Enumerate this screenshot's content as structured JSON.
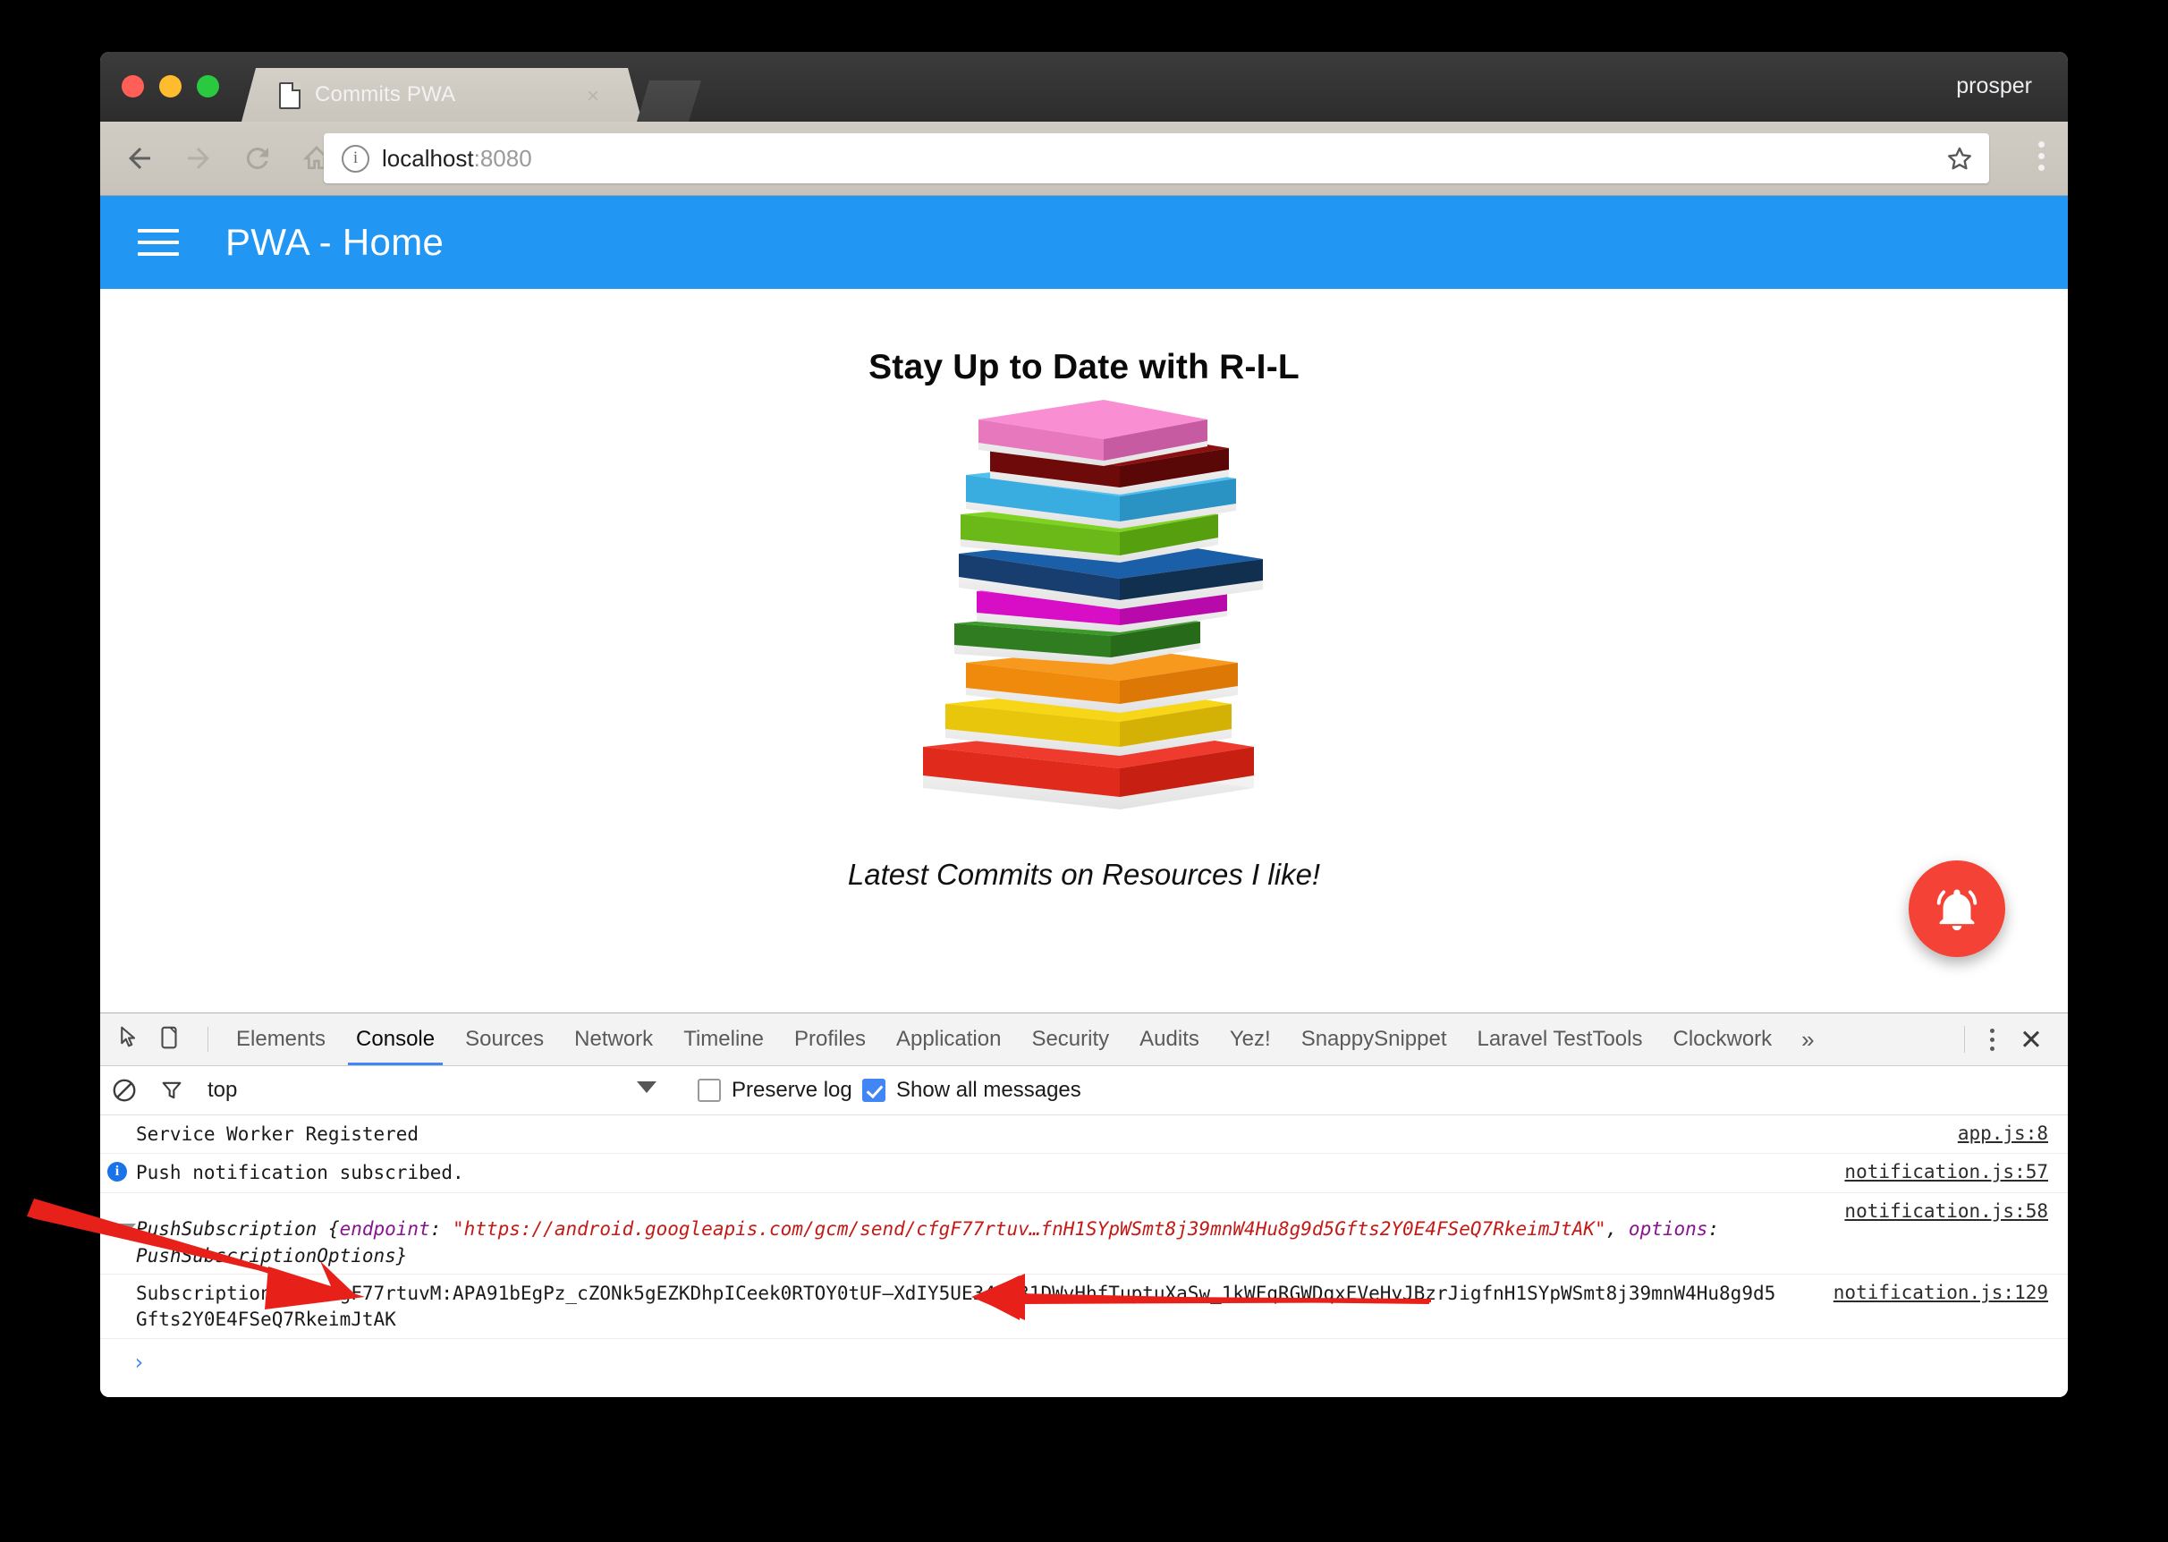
{
  "window": {
    "profile_name": "prosper",
    "tab": {
      "title": "Commits PWA",
      "close_label": "×",
      "favicon": "document-icon"
    },
    "omnibox": {
      "url_host": "localhost",
      "url_port": ":8080",
      "info_glyph": "ⓘ",
      "star": "bookmark-star-icon"
    },
    "nav": {
      "back": "back-arrow-icon",
      "forward": "forward-arrow-icon",
      "reload": "reload-icon",
      "home": "home-icon",
      "menu": "chrome-menu-icon"
    }
  },
  "app": {
    "appbar": {
      "menu_icon": "hamburger-icon",
      "title": "PWA - Home"
    },
    "heading": "Stay Up to Date with R-I-L",
    "subtitle": "Latest Commits on Resources I like!",
    "hero_image": "stack-of-colorful-books",
    "fab": {
      "icon": "notification-bell-icon",
      "color": "#f44336"
    }
  },
  "devtools": {
    "tools": {
      "inspect": "inspect-element-icon",
      "device": "device-toolbar-icon",
      "more": "»",
      "kebab": "kebab-menu-icon",
      "close": "✕"
    },
    "tabs": [
      {
        "label": "Elements",
        "active": false
      },
      {
        "label": "Console",
        "active": true
      },
      {
        "label": "Sources",
        "active": false
      },
      {
        "label": "Network",
        "active": false
      },
      {
        "label": "Timeline",
        "active": false
      },
      {
        "label": "Profiles",
        "active": false
      },
      {
        "label": "Application",
        "active": false
      },
      {
        "label": "Security",
        "active": false
      },
      {
        "label": "Audits",
        "active": false
      },
      {
        "label": "Yez!",
        "active": false
      },
      {
        "label": "SnappySnippet",
        "active": false
      },
      {
        "label": "Laravel TestTools",
        "active": false
      },
      {
        "label": "Clockwork",
        "active": false
      }
    ],
    "filterbar": {
      "clear_icon": "clear-console-icon",
      "filter_icon": "filter-funnel-icon",
      "context": "top",
      "preserve_log": {
        "label": "Preserve log",
        "checked": false
      },
      "show_all": {
        "label": "Show all messages",
        "checked": true
      }
    },
    "console": {
      "rows": [
        {
          "kind": "log",
          "text": "Service Worker Registered",
          "source": "app.js:8"
        },
        {
          "kind": "info",
          "text": "Push notification subscribed.",
          "source": "notification.js:57"
        },
        {
          "kind": "object",
          "prefix": "PushSubscription {",
          "key1": "endpoint",
          "sep1": ": ",
          "value1": "\"https://android.googleapis.com/gcm/send/cfgF77rtuv…fnH1SYpWSmt8j39mnW4Hu8g9d5Gfts2Y0E4FSeQ7RkeimJtAK\"",
          "comma": ", ",
          "key2": "options",
          "sep2": ":",
          "line2": "PushSubscriptionOptions}",
          "source": "notification.js:58"
        },
        {
          "kind": "log",
          "text": "Subscription ID cfgF77rtuvM:APA91bEgPz_cZONk5gEZKDhpICeek0RTOY0tUF—XdIY5UE34BQ31DWvHhfTuptuXaSw_1kWFqRGWDqxEVeHyJBzrJigfnH1SYpWSmt8j39mnW4Hu8g9d5Gfts2Y0E4FSeQ7RkeimJtAK",
          "source": "notification.js:129"
        }
      ],
      "prompt": "›"
    }
  },
  "annotations": {
    "arrow_1": "red-arrow-pointing-to-subscription-id",
    "arrow_2": "red-arrow-pointing-left-to-subscription-id",
    "color": "#e8201a"
  }
}
